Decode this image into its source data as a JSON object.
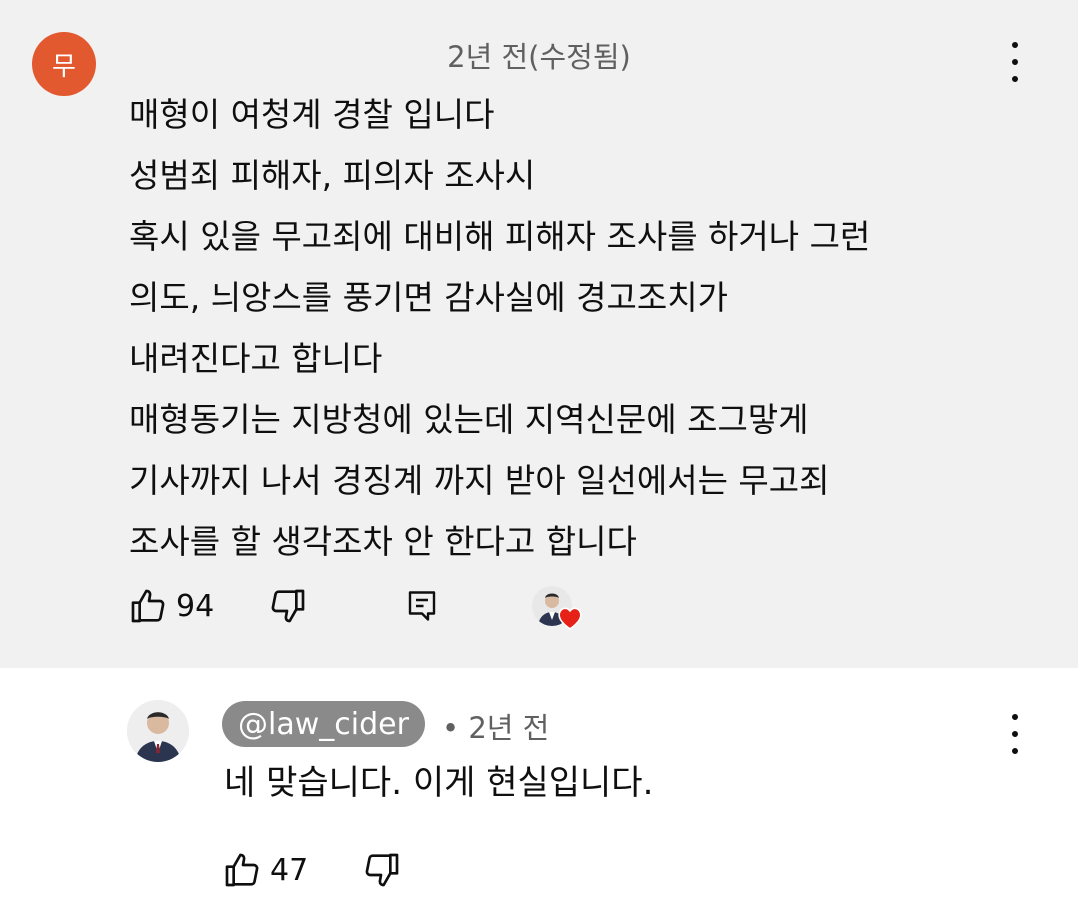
{
  "top_comment": {
    "avatar_letter": "무",
    "meta": "2년 전(수정됨)",
    "lines": [
      "매형이 여청계 경찰 입니다",
      "성범죄 피해자, 피의자 조사시",
      "혹시 있을 무고죄에 대비해 피해자 조사를 하거나 그런",
      "의도, 늬앙스를 풍기면 감사실에 경고조치가",
      "내려진다고 합니다",
      "매형동기는 지방청에 있는데 지역신문에 조그맣게",
      "기사까지 나서 경징계 까지 받아 일선에서는 무고죄",
      "조사를 할 생각조차 안 한다고 합니다"
    ],
    "like_count": "94",
    "icons": [
      "like-icon",
      "dislike-icon",
      "reply-icon",
      "creator-heart-icon",
      "more-options-icon"
    ]
  },
  "reply": {
    "handle": "@law_cider",
    "meta": "• 2년 전",
    "text": "네 맞습니다. 이게 현실입니다.",
    "like_count": "47",
    "icons": [
      "like-icon",
      "dislike-icon",
      "more-options-icon"
    ]
  },
  "colors": {
    "top_background": "#f1f1f1",
    "avatar_orange": "#e2592f",
    "handle_chip": "#8a8a8a",
    "heart_red": "#e62117",
    "meta_gray": "#606060"
  }
}
